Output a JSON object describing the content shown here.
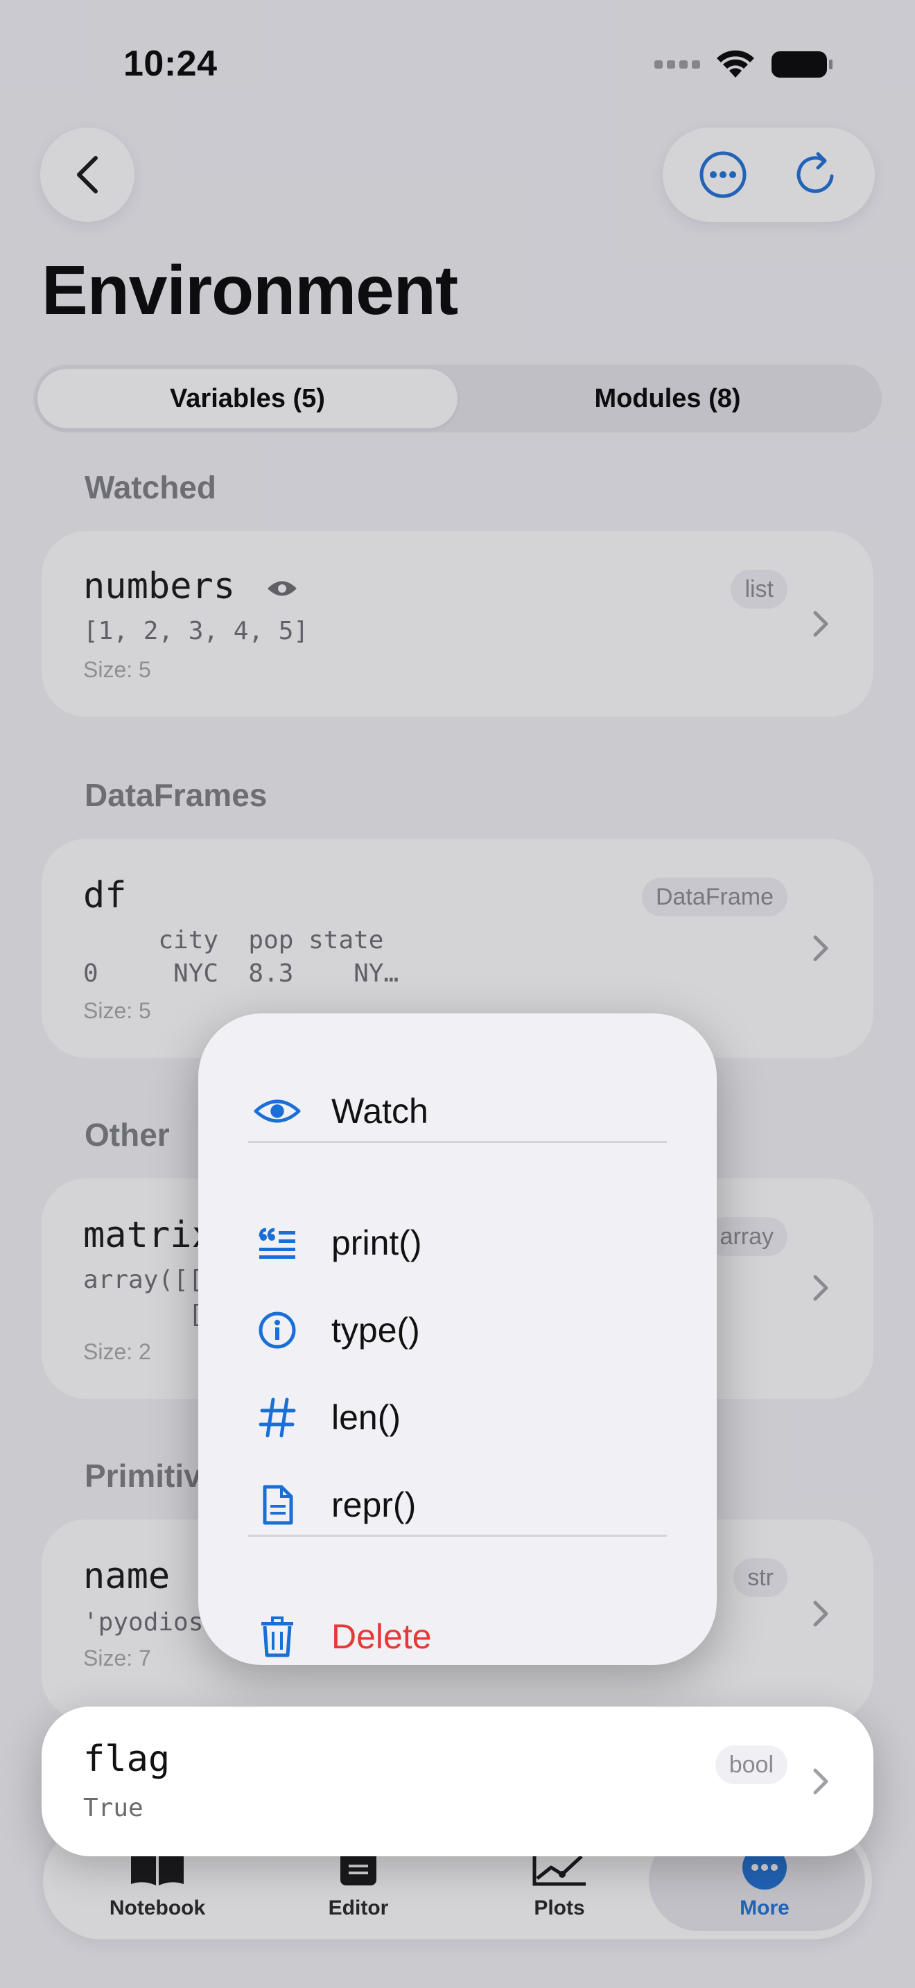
{
  "status_bar": {
    "time": "10:24"
  },
  "page": {
    "title": "Environment"
  },
  "segments": [
    {
      "label": "Variables (5)",
      "active": true
    },
    {
      "label": "Modules (8)",
      "active": false
    }
  ],
  "sections": {
    "watched": "Watched",
    "dataframes": "DataFrames",
    "other": "Other",
    "primitives": "Primitiv"
  },
  "variables": {
    "numbers": {
      "name": "numbers",
      "value": "[1, 2, 3, 4, 5]",
      "size": "Size: 5",
      "type": "list"
    },
    "df": {
      "name": "df",
      "value_line1": "     city  pop state",
      "value_line2": "0     NYC  8.3    NY…",
      "size": "Size: 5",
      "type": "DataFrame"
    },
    "matrix": {
      "name": "matrix",
      "value_line1": "array([[",
      "value_line2": "       [",
      "size": "Size: 2",
      "type": "array"
    },
    "name": {
      "name": "name",
      "value": "'pyodios",
      "size": "Size: 7",
      "type": "str"
    },
    "flag": {
      "name": "flag",
      "value": "True",
      "type": "bool"
    }
  },
  "context_menu": {
    "items": [
      {
        "label": "Watch",
        "icon": "eye-icon"
      },
      {
        "label": "print()",
        "icon": "quote-lines-icon"
      },
      {
        "label": "type()",
        "icon": "info-icon"
      },
      {
        "label": "len()",
        "icon": "hash-icon"
      },
      {
        "label": "repr()",
        "icon": "document-icon"
      },
      {
        "label": "Delete",
        "icon": "trash-icon",
        "destructive": true
      }
    ]
  },
  "tabbar": [
    {
      "label": "Notebook",
      "icon": "book-icon"
    },
    {
      "label": "Editor",
      "icon": "editor-icon"
    },
    {
      "label": "Plots",
      "icon": "chart-icon"
    },
    {
      "label": "More",
      "icon": "more-icon",
      "active": true
    }
  ],
  "colors": {
    "accent": "#1a6fd6",
    "destructive": "#e53935",
    "background": "#f2f2f7"
  }
}
